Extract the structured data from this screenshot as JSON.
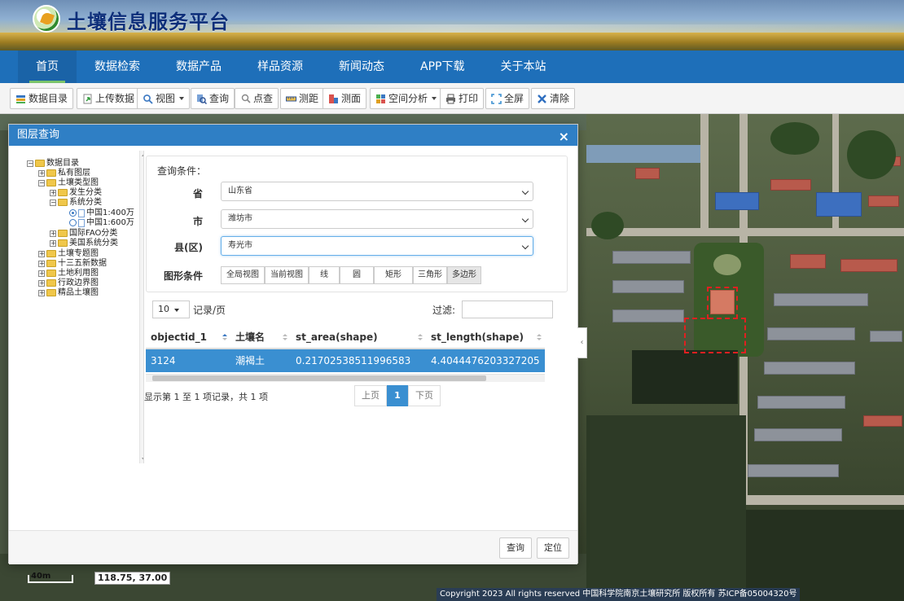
{
  "site": {
    "title": "土壤信息服务平台",
    "logo_icon": "platform-logo-icon"
  },
  "nav": {
    "items": [
      "首页",
      "数据检索",
      "数据产品",
      "样品资源",
      "新闻动态",
      "APP下载",
      "关于本站"
    ],
    "active": "首页"
  },
  "toolbar": {
    "catalog": "数据目录",
    "upload": "上传数据",
    "view": "视图",
    "query": "查询",
    "point_check": "点查",
    "measure_distance": "测距",
    "measure_area": "测面",
    "spatial_analysis": "空间分析",
    "print": "打印",
    "fullscreen": "全屏",
    "clear": "清除"
  },
  "dialog": {
    "title": "图层查询",
    "close": "×",
    "tree": [
      "数据目录",
      "私有图层",
      "土壤类型图",
      "发生分类",
      "系统分类",
      "中国1:400万",
      "中国1:600万",
      "国际FAO分类",
      "美国系统分类",
      "土壤专题图",
      "十三五新数据",
      "土地利用图",
      "行政边界图",
      "精品土壤图"
    ],
    "query": {
      "title": "查询条件：",
      "province_label": "省",
      "province_value": "山东省",
      "city_label": "市",
      "city_value": "潍坊市",
      "county_label": "县(区)",
      "county_value": "寿光市",
      "shape_label": "图形条件",
      "shapes": [
        "全局视图",
        "当前视图",
        "线",
        "圆",
        "矩形",
        "三角形",
        "多边形"
      ],
      "active_shape": "多边形"
    },
    "table": {
      "page_size": "10",
      "page_size_label": "记录/页",
      "filter_label": "过滤:",
      "filter_value": "",
      "columns": [
        "objectid_1",
        "土壤名",
        "st_area(shape)",
        "st_length(shape)"
      ],
      "rows": [
        [
          "3124",
          "潮褐土",
          "0.21702538511996583",
          "4.4044476203327205"
        ]
      ],
      "info": "显示第 1 至 1 项记录，共 1 项",
      "prev": "上页",
      "current_page": "1",
      "next": "下页"
    },
    "footer": {
      "query": "查询",
      "locate": "定位"
    }
  },
  "map": {
    "coordinates": "118.75, 37.00",
    "scale": "40m",
    "copyright": "Copyright 2023 All rights reserved 中国科学院南京土壤研究所 版权所有 苏ICP备05004320号"
  }
}
